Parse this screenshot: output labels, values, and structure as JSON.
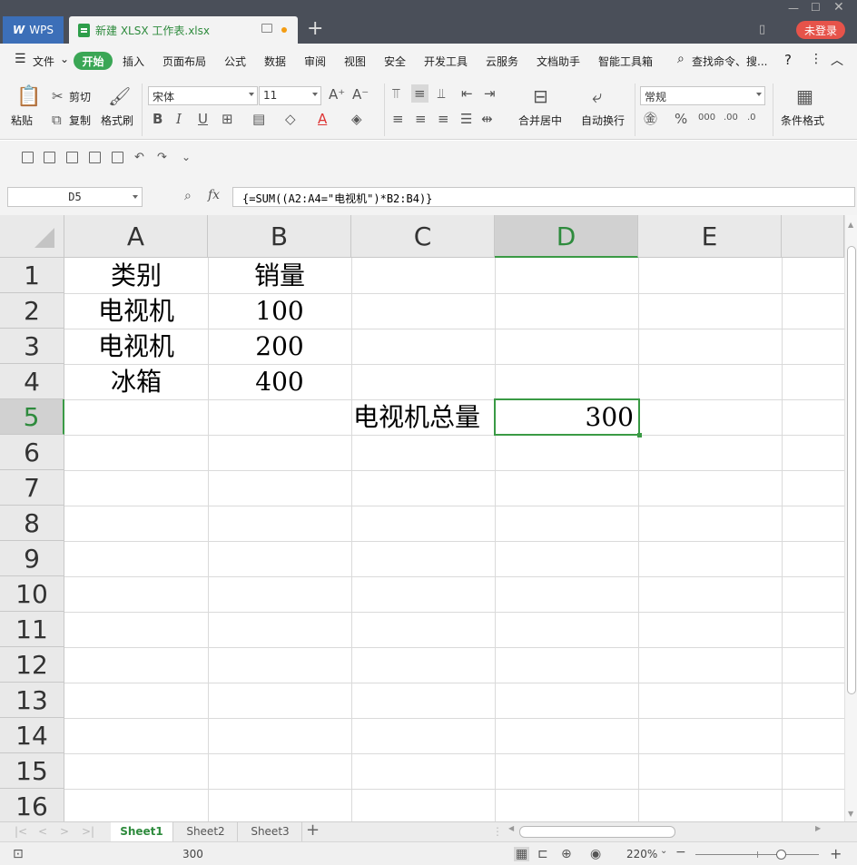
{
  "titlebar": {
    "app_tab": "WPS",
    "doc_tab": "新建 XLSX 工作表.xlsx",
    "new_tab": "+",
    "login_label": "未登录"
  },
  "menubar": {
    "file": "文件",
    "active_tab": "开始",
    "items": [
      "插入",
      "页面布局",
      "公式",
      "数据",
      "审阅",
      "视图",
      "安全",
      "开发工具",
      "云服务",
      "文档助手",
      "智能工具箱"
    ],
    "search": "查找命令、搜..."
  },
  "ribbon": {
    "paste": "粘贴",
    "cut": "剪切",
    "copy": "复制",
    "format_painter": "格式刷",
    "font_name": "宋体",
    "font_size": "11",
    "merge_center": "合并居中",
    "wrap_text": "自动换行",
    "number_format": "常规",
    "conditional_format": "条件格式"
  },
  "formula_bar": {
    "name_box": "D5",
    "fx": "fx",
    "formula": "{=SUM((A2:A4=\"电视机\")*B2:B4)}"
  },
  "grid": {
    "columns": [
      "A",
      "B",
      "C",
      "D",
      "E"
    ],
    "active_column": "D",
    "rows": [
      "1",
      "2",
      "3",
      "4",
      "5",
      "6",
      "7",
      "8",
      "9",
      "10",
      "11",
      "12",
      "13",
      "14",
      "15",
      "16"
    ],
    "active_row": "5",
    "cells": {
      "A1": "类别",
      "B1": "销量",
      "A2": "电视机",
      "B2": "100",
      "A3": "电视机",
      "B3": "200",
      "A4": "冰箱",
      "B4": "400",
      "C5": "电视机总量",
      "D5": "300"
    }
  },
  "sheets": {
    "tabs": [
      "Sheet1",
      "Sheet2",
      "Sheet3"
    ],
    "active": "Sheet1"
  },
  "status": {
    "value": "300",
    "zoom": "220%"
  },
  "colors": {
    "accent_green": "#3aa655",
    "title_bg": "#4a4f59",
    "wps_blue": "#3c6fb8",
    "login_red": "#e6534a"
  }
}
